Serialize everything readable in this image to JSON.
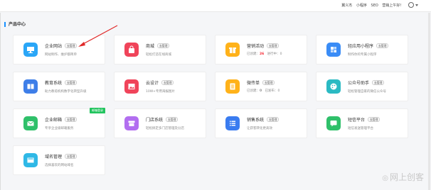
{
  "topnav": {
    "items": [
      "翼义杰",
      "小程序",
      "SEO",
      "营销上午好!"
    ]
  },
  "section": {
    "title": "产品中心"
  },
  "manage_label": "去管理",
  "cards": [
    {
      "name": "企业网站",
      "desc": "网站制作、维护都简单",
      "color": "#2aa6f7",
      "icon": "monitor-icon"
    },
    {
      "name": "商城",
      "desc": "轻松打造在线商城",
      "color": "#f0445a",
      "icon": "shop-bag-icon"
    },
    {
      "name": "营销活动",
      "stat_label1": "已创建：",
      "stat_val1": "26",
      "stat_label2": "进行中：",
      "stat_val2": "0",
      "color": "#ffb21a",
      "icon": "gift-icon"
    },
    {
      "name": "轻应用小程序",
      "desc": "制作你的专属小程序",
      "color": "#3a8cf6",
      "icon": "puzzle-icon"
    },
    {
      "name": "教育系统",
      "desc": "助力教培机构数字化转型升级",
      "color": "#3e7ee8",
      "icon": "book-icon"
    },
    {
      "name": "云设计",
      "desc": "10W+专用海报图片",
      "color": "#f0445a",
      "icon": "image-icon"
    },
    {
      "name": "微传单",
      "stat_label1": "已创建：",
      "stat_val1": "0",
      "stat_label2": "已发布：",
      "stat_val2": "0",
      "color": "#ffb21a",
      "icon": "document-icon"
    },
    {
      "name": "公众号助手",
      "desc": "轻松管理自家的微信公众号",
      "color": "#2bbac3",
      "icon": "palette-icon"
    },
    {
      "name": "企业邮箱",
      "desc": "专享企业级邮箱服务",
      "color": "#2fc06a",
      "icon": "mail-icon",
      "badge": "邮箱登录"
    },
    {
      "name": "门店系统",
      "desc": "轻松搞定多门店管理及分店",
      "color": "#b26ef0",
      "icon": "store-icon"
    },
    {
      "name": "销售系统",
      "desc": "让获客转化更高效",
      "color": "#3a7cf0",
      "icon": "list-icon"
    },
    {
      "name": "短信平台",
      "desc": "短信发送管理平台",
      "color": "#2fc06a",
      "icon": "sms-icon"
    },
    {
      "name": "域名管理",
      "desc": "选择喜欢的网站域名",
      "color": "#2fb8e6",
      "icon": "domain-icon"
    }
  ],
  "watermark": {
    "text": "网上创客"
  }
}
